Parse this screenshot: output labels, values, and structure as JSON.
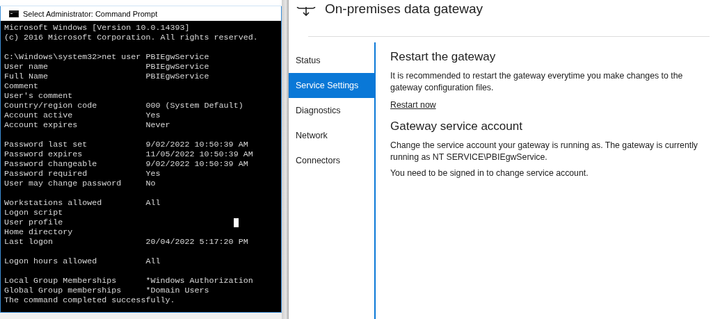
{
  "console_window": {
    "title": "Select Administrator: Command Prompt",
    "groups": [
      {
        "lines": [
          {
            "label": "Microsoft Windows [Version 10.0.14393]"
          },
          {
            "label": "(c) 2016 Microsoft Corporation. All rights reserved."
          }
        ]
      },
      {
        "lines": [
          {
            "label": "C:\\Windows\\system32>net user PBIEgwService"
          },
          {
            "label": "User name",
            "value": "PBIEgwService"
          },
          {
            "label": "Full Name",
            "value": "PBIEgwService"
          },
          {
            "label": "Comment"
          },
          {
            "label": "User's comment"
          },
          {
            "label": "Country/region code",
            "value": "000 (System Default)"
          },
          {
            "label": "Account active",
            "value": "Yes"
          },
          {
            "label": "Account expires",
            "value": "Never"
          }
        ]
      },
      {
        "lines": [
          {
            "label": "Password last set",
            "value": "9/02/2022 10:50:39 AM"
          },
          {
            "label": "Password expires",
            "value": "11/05/2022 10:50:39 AM"
          },
          {
            "label": "Password changeable",
            "value": "9/02/2022 10:50:39 AM"
          },
          {
            "label": "Password required",
            "value": "Yes"
          },
          {
            "label": "User may change password",
            "value": "No"
          }
        ]
      },
      {
        "lines": [
          {
            "label": "Workstations allowed",
            "value": "All"
          },
          {
            "label": "Logon script"
          },
          {
            "label": "User profile",
            "cursor": true
          },
          {
            "label": "Home directory"
          },
          {
            "label": "Last logon",
            "value": "20/04/2022 5:17:20 PM"
          }
        ]
      },
      {
        "lines": [
          {
            "label": "Logon hours allowed",
            "value": "All"
          }
        ]
      },
      {
        "lines": [
          {
            "label": "Local Group Memberships",
            "value": "*Windows Authorization"
          },
          {
            "label": "Global Group memberships",
            "value": "*Domain Users"
          },
          {
            "label": "The command completed successfully."
          }
        ]
      }
    ]
  },
  "gateway_window": {
    "title": "On-premises data gateway",
    "nav": [
      {
        "label": "Status",
        "selected": false
      },
      {
        "label": "Service Settings",
        "selected": true
      },
      {
        "label": "Diagnostics",
        "selected": false
      },
      {
        "label": "Network",
        "selected": false
      },
      {
        "label": "Connectors",
        "selected": false
      }
    ],
    "sections": [
      {
        "heading": "Restart the gateway",
        "paragraphs": [
          "It is recommended to restart the gateway everytime you make changes to the gateway configuration files."
        ],
        "link": "Restart now"
      },
      {
        "heading": "Gateway service account",
        "paragraphs": [
          "Change the service account your gateway is running as. The gateway is currently running as NT SERVICE\\PBIEgwService.",
          "You need to be signed in to change service account."
        ]
      }
    ]
  }
}
